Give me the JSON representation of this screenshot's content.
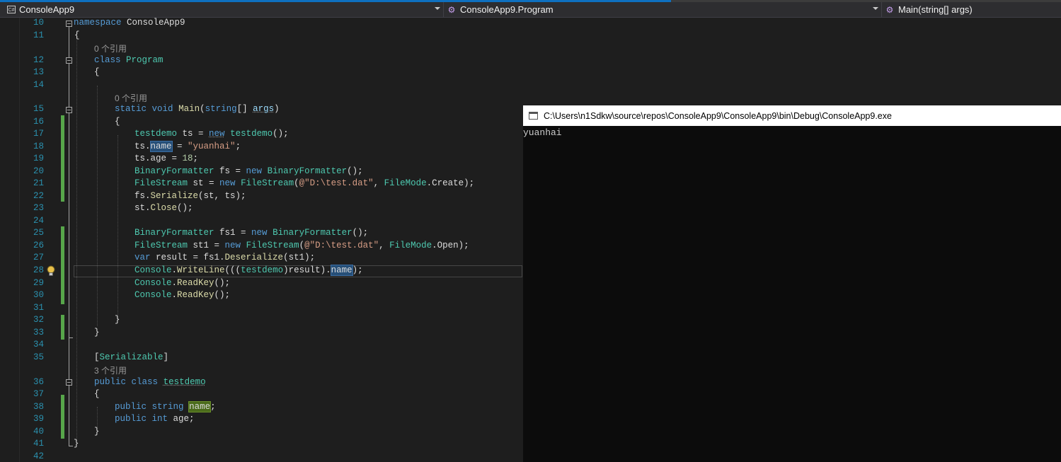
{
  "nav": {
    "project": "ConsoleApp9",
    "class": "ConsoleApp9.Program",
    "member": "Main(string[] args)",
    "project_icon": "csharp-project-icon",
    "member_icon": "method-icon"
  },
  "colors": {
    "keyword": "#569cd6",
    "type": "#4ec9b0",
    "string": "#d69d85",
    "number": "#b5cea8",
    "method": "#dcdcaa",
    "line_number": "#2b91af",
    "changed_bar": "#57a64a"
  },
  "code_lens": {
    "program_refs": "0 个引用",
    "main_refs": "0 个引用",
    "testdemo_refs": "3 个引用"
  },
  "lines": [
    {
      "num": "10"
    },
    {
      "num": "11"
    },
    {
      "num": "12"
    },
    {
      "num": "13"
    },
    {
      "num": "14"
    },
    {
      "num": "15"
    },
    {
      "num": "16"
    },
    {
      "num": "17"
    },
    {
      "num": "18"
    },
    {
      "num": "19"
    },
    {
      "num": "20"
    },
    {
      "num": "21"
    },
    {
      "num": "22"
    },
    {
      "num": "23"
    },
    {
      "num": "24"
    },
    {
      "num": "25"
    },
    {
      "num": "26"
    },
    {
      "num": "27"
    },
    {
      "num": "28"
    },
    {
      "num": "29"
    },
    {
      "num": "30"
    },
    {
      "num": "31"
    },
    {
      "num": "32"
    },
    {
      "num": "33"
    },
    {
      "num": "34"
    },
    {
      "num": "35"
    },
    {
      "num": "36"
    },
    {
      "num": "37"
    },
    {
      "num": "38"
    },
    {
      "num": "39"
    },
    {
      "num": "40"
    },
    {
      "num": "41"
    },
    {
      "num": "42"
    }
  ],
  "code": {
    "l10_kw": "namespace",
    "l10_name": " ConsoleApp9",
    "brace_open": "{",
    "brace_close": "}",
    "l12_kw": "class",
    "l12_name": "Program",
    "l15_kw1": "static",
    "l15_kw2": "void",
    "l15_name": "Main",
    "l15_p1": "(",
    "l15_kw3": "string",
    "l15_p2": "[] ",
    "l15_arg": "args",
    "l15_p3": ")",
    "l17_t1": "testdemo",
    "l17_v": " ts = ",
    "l17_kw": "new",
    "l17_t2": "testdemo",
    "l17_e": "();",
    "l18_a": "ts.",
    "l18_hl": "name",
    "l18_b": " = ",
    "l18_str": "\"yuanhai\"",
    "l18_c": ";",
    "l19_a": "ts.age = ",
    "l19_num": "18",
    "l19_c": ";",
    "l20_t1": "BinaryFormatter",
    "l20_v": " fs = ",
    "l20_kw": "new",
    "l20_t2": "BinaryFormatter",
    "l20_e": "();",
    "l21_t1": "FileStream",
    "l21_v": " st = ",
    "l21_kw": "new",
    "l21_t2": "FileStream",
    "l21_p": "(",
    "l21_str": "@\"D:\\test.dat\"",
    "l21_c": ", ",
    "l21_t3": "FileMode",
    "l21_d": ".Create);",
    "l22_a": "fs.",
    "l22_m": "Serialize",
    "l22_b": "(st, ts);",
    "l23_a": "st.",
    "l23_m": "Close",
    "l23_b": "();",
    "l25_t1": "BinaryFormatter",
    "l25_v": " fs1 = ",
    "l25_kw": "new",
    "l25_t2": "BinaryFormatter",
    "l25_e": "();",
    "l26_t1": "FileStream",
    "l26_v": " st1 = ",
    "l26_kw": "new",
    "l26_t2": "FileStream",
    "l26_p": "(",
    "l26_str": "@\"D:\\test.dat\"",
    "l26_c": ", ",
    "l26_t3": "FileMode",
    "l26_d": ".Open);",
    "l27_kw": "var",
    "l27_v": " result = fs1.",
    "l27_m": "Deserialize",
    "l27_b": "(st1);",
    "l28_t1": "Console",
    "l28_a": ".",
    "l28_m": "WriteLine",
    "l28_b": "(((",
    "l28_t2": "testdemo",
    "l28_c": ")result).",
    "l28_hl": "name",
    "l28_d": ");",
    "l29_t1": "Console",
    "l29_a": ".",
    "l29_m": "ReadKey",
    "l29_b": "();",
    "l30_t1": "Console",
    "l30_a": ".",
    "l30_m": "ReadKey",
    "l30_b": "();",
    "l35_attr": "[",
    "l35_t": "Serializable",
    "l35_e": "]",
    "l36_kw1": "public",
    "l36_kw2": "class",
    "l36_name": "testdemo",
    "l38_kw1": "public",
    "l38_kw2": "string",
    "l38_hl": "name",
    "l38_e": ";",
    "l39_kw1": "public",
    "l39_kw2": "int",
    "l39_e": " age;"
  },
  "console": {
    "title": "C:\\Users\\n1Sdkw\\source\\repos\\ConsoleApp9\\ConsoleApp9\\bin\\Debug\\ConsoleApp9.exe",
    "output": "yuanhai",
    "icon": "console-window-icon"
  }
}
